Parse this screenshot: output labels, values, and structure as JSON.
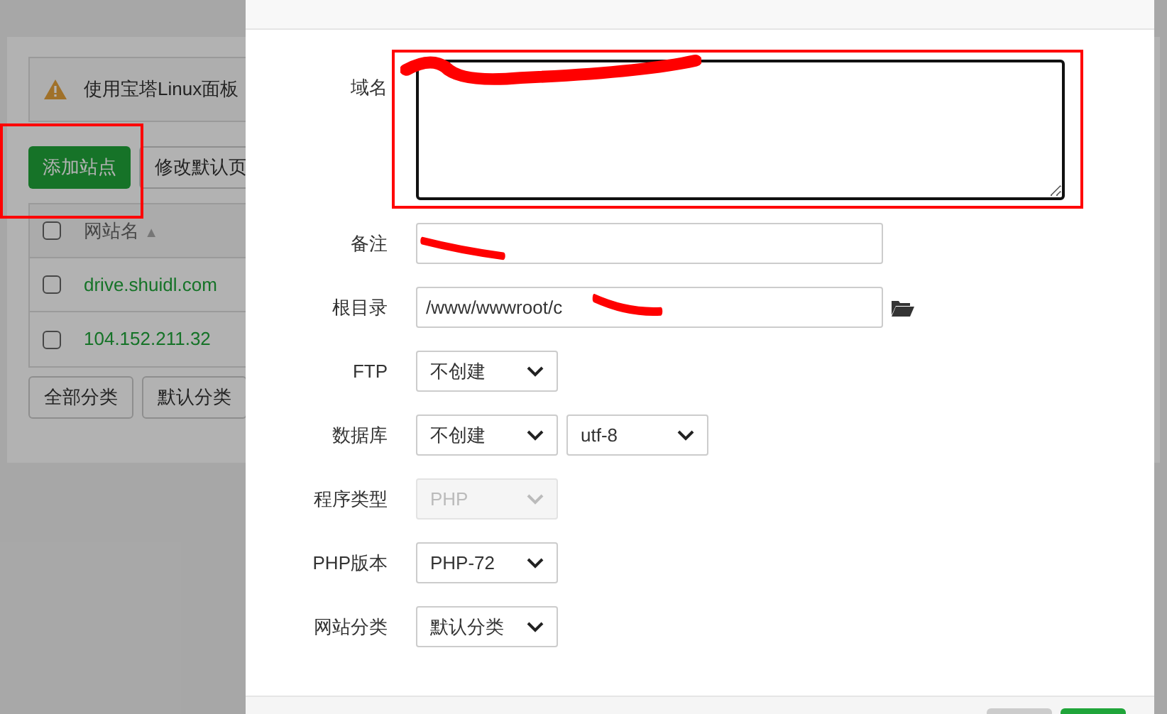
{
  "background": {
    "alert": {
      "text": "使用宝塔Linux面板"
    },
    "buttons": [
      {
        "label": "添加站点",
        "kind": "primary"
      },
      {
        "label": "修改默认页",
        "kind": "default"
      }
    ],
    "table": {
      "columns": [
        {
          "label": "网站名",
          "sort": "▲"
        }
      ],
      "rows": [
        {
          "name": "drive.shuidl.com",
          "checked": false
        },
        {
          "name": "104.152.211.32",
          "checked": false
        }
      ],
      "header_checked": false
    },
    "categories": [
      {
        "label": "全部分类"
      },
      {
        "label": "默认分类"
      }
    ]
  },
  "dialog": {
    "fields": [
      {
        "kind": "textarea",
        "label": "域名"
      },
      {
        "kind": "input",
        "label": "备注"
      },
      {
        "kind": "path",
        "label": "根目录",
        "value": "/www/wwwroot/c"
      },
      {
        "kind": "select",
        "label": "FTP",
        "options": [
          {
            "value": "不创建",
            "disabled": false
          }
        ]
      },
      {
        "kind": "select",
        "label": "数据库",
        "options": [
          {
            "value": "不创建",
            "disabled": false
          },
          {
            "value": "utf-8",
            "disabled": false
          }
        ]
      },
      {
        "kind": "select",
        "label": "程序类型",
        "options": [
          {
            "value": "PHP",
            "disabled": true
          }
        ]
      },
      {
        "kind": "select",
        "label": "PHP版本",
        "options": [
          {
            "value": "PHP-72",
            "disabled": false
          }
        ]
      },
      {
        "kind": "select",
        "label": "网站分类",
        "options": [
          {
            "value": "默认分类",
            "disabled": false
          }
        ]
      }
    ]
  }
}
